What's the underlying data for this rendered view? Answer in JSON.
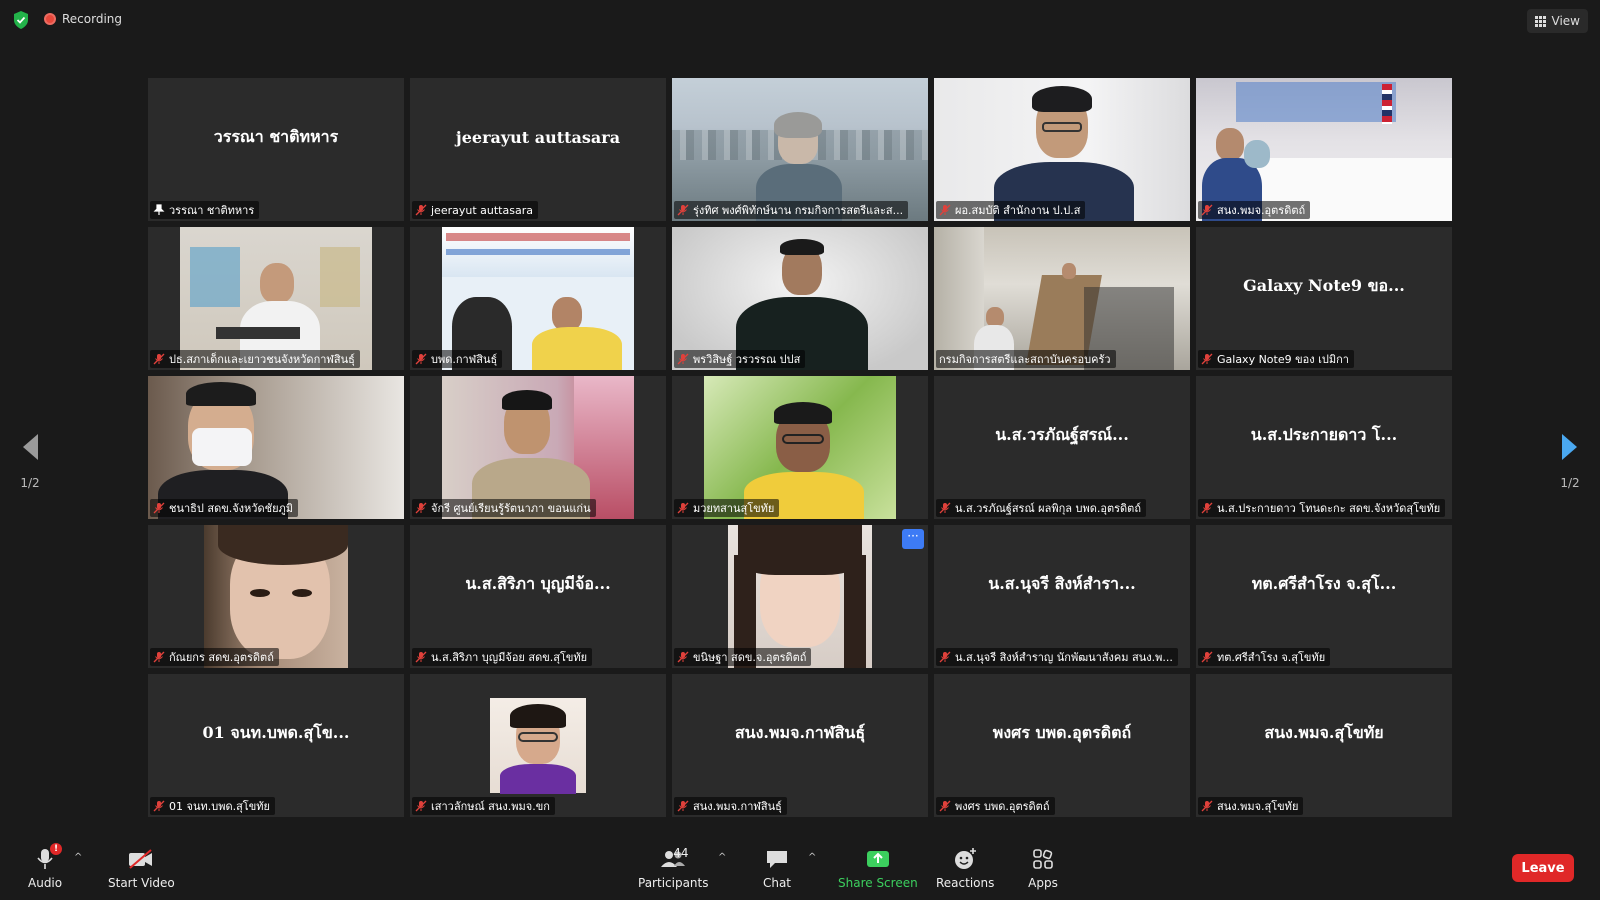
{
  "topbar": {
    "recording_label": "Recording",
    "view_label": "View"
  },
  "pagination": {
    "prev_page": "1/2",
    "next_page": "1/2"
  },
  "tiles": [
    {
      "display": "วรรณา ชาติทหาร",
      "name": "วรรณา ชาติทหาร",
      "video": false,
      "pinned": true
    },
    {
      "display": "jeerayut auttasara",
      "name": "jeerayut auttasara",
      "video": false
    },
    {
      "name": "รุ่งทิศ พงศ์พิทักษ์นาน กรมกิจการสตรีและส...",
      "video": true
    },
    {
      "name": "ผอ.สมบัติ สำนักงาน ป.ป.ส",
      "video": true
    },
    {
      "name": "สนง.พมจ.อุตรดิตถ์",
      "video": true
    },
    {
      "name": "ปธ.สภาเด็กและเยาวชนจังหวัดกาฬสินธุ์",
      "video": true
    },
    {
      "name": "บพด.กาฬสินธุ์",
      "video": true
    },
    {
      "name": "พรวิสิษฐ์ วรวรรณ ปปส",
      "video": true
    },
    {
      "name": "กรมกิจการสตรีและสถาบันครอบครัว",
      "video": true,
      "active": true
    },
    {
      "display": "Galaxy Note9 ขอ...",
      "name": "Galaxy Note9 ของ เปมิกา",
      "video": false
    },
    {
      "name": "ชนาธิป สดข.จังหวัดชัยภูมิ",
      "video": true
    },
    {
      "name": "จักรี ศูนย์เรียนรู้รัตนาภา ขอนแก่น",
      "video": true
    },
    {
      "name": "มวยทสานสุโขทัย",
      "video": true
    },
    {
      "display": "น.ส.วรภัณฐ์สรณ์...",
      "name": "น.ส.วรภัณฐ์สรณ์ ผลพิกุล บพด.อุตรดิตถ์",
      "video": false
    },
    {
      "display": "น.ส.ประกายดาว โ...",
      "name": "น.ส.ประกายดาว โทนดะกะ สดข.จังหวัดสุโขทัย",
      "video": false
    },
    {
      "name": "กัณยกร สดข.อุตรดิตถ์",
      "video": true
    },
    {
      "display": "น.ส.สิริภา บุญมีจ้อ...",
      "name": "น.ส.สิริภา บุญมีจ้อย สดข.สุโขทัย",
      "video": false
    },
    {
      "name": "ขนิษฐา สดข.จ.อุตรดิตถ์",
      "video": true,
      "more": true
    },
    {
      "display": "น.ส.นุจรี สิงห์สำรา...",
      "name": "น.ส.นุจรี สิงห์สำราญ นักพัฒนาสังคม สนง.พ...",
      "video": false
    },
    {
      "display": "ทต.ศรีสำโรง จ.สุโ...",
      "name": "ทต.ศรีสำโรง จ.สุโขทัย",
      "video": false
    },
    {
      "display": "01 จนท.บพด.สุโข...",
      "name": "01 จนท.บพด.สุโขทัย",
      "video": false
    },
    {
      "name": "เสาวลักษณ์ สนง.พมจ.ขก",
      "video": true
    },
    {
      "display": "สนง.พมจ.กาฬสินธุ์",
      "name": "สนง.พมจ.กาฬสินธุ์",
      "video": false
    },
    {
      "display": "พงศร บพด.อุตรดิตถ์",
      "name": "พงศร บพด.อุตรดิตถ์",
      "video": false
    },
    {
      "display": "สนง.พมจ.สุโขทัย",
      "name": "สนง.พมจ.สุโขทัย",
      "video": false
    }
  ],
  "toolbar": {
    "audio_label": "Audio",
    "audio_badge": "!",
    "video_label": "Start Video",
    "participants_label": "Participants",
    "participants_count": "44",
    "chat_label": "Chat",
    "share_label": "Share Screen",
    "reactions_label": "Reactions",
    "apps_label": "Apps",
    "leave_label": "Leave"
  },
  "colors": {
    "accent_green": "#3ccf5e",
    "leave_red": "#e02828",
    "active_speaker": "#d4d16a",
    "nav_arrow": "#4aa8f0"
  }
}
